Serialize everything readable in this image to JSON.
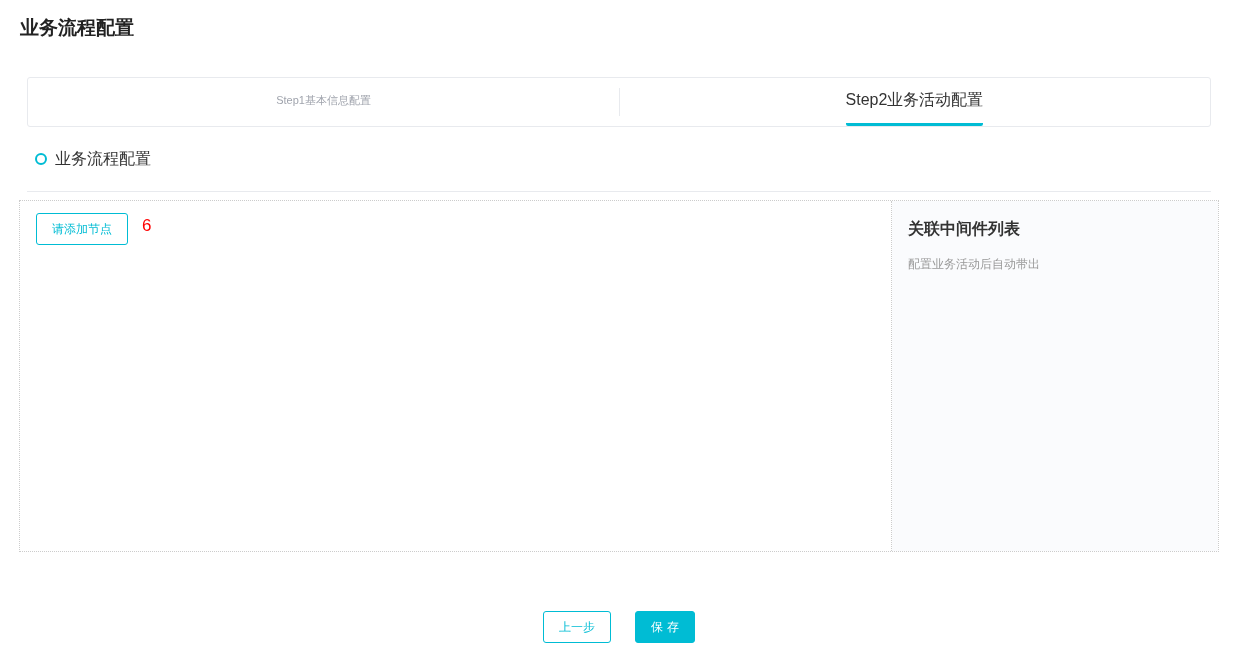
{
  "page_title": "业务流程配置",
  "steps": [
    {
      "label": "Step1基本信息配置",
      "selected": false
    },
    {
      "label": "Step2业务活动配置",
      "selected": true
    }
  ],
  "section": {
    "title": "业务流程配置"
  },
  "canvas": {
    "add_button": "请添加节点",
    "node_count": "6"
  },
  "side_panel": {
    "title": "关联中间件列表",
    "hint": "配置业务活动后自动带出"
  },
  "buttons": [
    {
      "label": "上一步",
      "kind": "secondary"
    },
    {
      "label": "保 存",
      "kind": "primary"
    }
  ]
}
